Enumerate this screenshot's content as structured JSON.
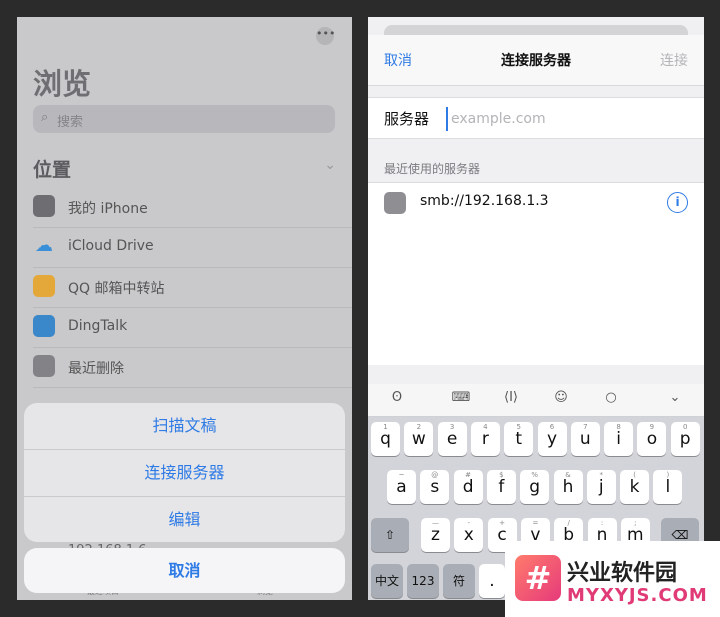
{
  "left": {
    "title": "浏览",
    "search_placeholder": "搜索",
    "section_title": "位置",
    "locations": [
      {
        "label": "我的 iPhone",
        "icon": "phone-icon"
      },
      {
        "label": "iCloud Drive",
        "icon": "cloud-icon"
      },
      {
        "label": "QQ 邮箱中转站",
        "icon": "mail-icon"
      },
      {
        "label": "DingTalk",
        "icon": "dingtalk-icon"
      },
      {
        "label": "最近删除",
        "icon": "trash-icon"
      }
    ],
    "recent_item": "192.168.1.6",
    "tabbar": {
      "recent": "最近项目",
      "browse": "浏览"
    },
    "action_sheet": {
      "items": [
        "扫描文稿",
        "连接服务器",
        "编辑"
      ],
      "cancel": "取消"
    }
  },
  "right": {
    "nav": {
      "cancel": "取消",
      "title": "连接服务器",
      "connect": "连接"
    },
    "server_label": "服务器",
    "server_placeholder": "example.com",
    "recent_header": "最近使用的服务器",
    "recent_server": "smb://192.168.1.3",
    "keyboard": {
      "row1": [
        "q",
        "w",
        "e",
        "r",
        "t",
        "y",
        "u",
        "i",
        "o",
        "p"
      ],
      "row1_nums": [
        "1",
        "2",
        "3",
        "4",
        "5",
        "6",
        "7",
        "8",
        "9",
        "0"
      ],
      "row2": [
        "a",
        "s",
        "d",
        "f",
        "g",
        "h",
        "j",
        "k",
        "l"
      ],
      "row2_syms": [
        "~",
        "@",
        "#",
        "$",
        "%",
        "&",
        "*",
        "(",
        ")"
      ],
      "row3": [
        "z",
        "x",
        "c",
        "v",
        "b",
        "n",
        "m"
      ],
      "row3_syms": [
        "—",
        "-",
        "+",
        "=",
        "/",
        ":",
        ";"
      ],
      "bottom": [
        "中文",
        "123",
        "符",
        "."
      ]
    }
  },
  "watermark": {
    "badge": "#",
    "cn": "兴业软件园",
    "en": "MYXYJS.COM"
  }
}
